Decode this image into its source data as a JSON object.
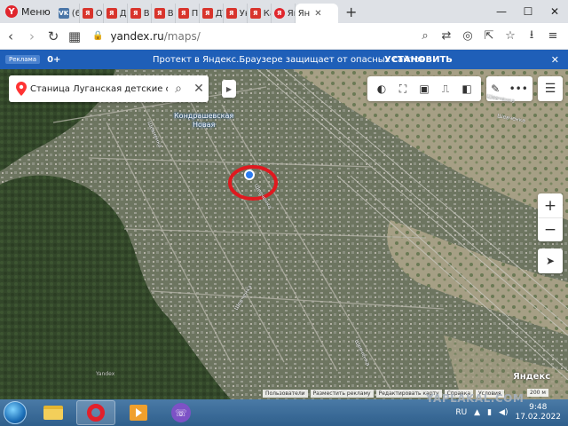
{
  "browser": {
    "menu_label": "Меню",
    "tabs": [
      {
        "label": "(6",
        "favicon": "vk",
        "active": false
      },
      {
        "label": "О",
        "favicon": "yap",
        "active": false
      },
      {
        "label": "Дс",
        "favicon": "yap",
        "active": false
      },
      {
        "label": "В",
        "favicon": "yap",
        "active": false
      },
      {
        "label": "В",
        "favicon": "yap",
        "active": false
      },
      {
        "label": "П",
        "favicon": "yap",
        "active": false
      },
      {
        "label": "ДТ",
        "favicon": "yap",
        "active": false
      },
      {
        "label": "Ук",
        "favicon": "yap",
        "active": false
      },
      {
        "label": "Ка",
        "favicon": "yap",
        "active": false
      },
      {
        "label": "Ян",
        "favicon": "ya",
        "active": false
      },
      {
        "label": "Ян",
        "favicon": "map",
        "active": true
      }
    ],
    "address": {
      "host": "yandex.ru",
      "path": "/maps/"
    }
  },
  "protect_banner": {
    "badge": "Реклама",
    "age": "0+",
    "message": "Протект в Яндекс.Браузере защищает от опасных сайтов",
    "install_label": "УСТАНОВИТЬ"
  },
  "map": {
    "search_value": "Станица Луганская детские сад",
    "place_label_line1": "Кондрашевская",
    "place_label_line2": "Новая",
    "brand": "Яндекс",
    "copyright_links": [
      "Пользователи",
      "Разместить рекламу",
      "Редактировать карту",
      "Справка",
      "Условия"
    ],
    "scale": "200 м",
    "streets": [
      "Шевченка",
      "Шевченка",
      "Yandex",
      "Шевченка",
      "Шевченка",
      "Шевченка",
      "Шевченка"
    ]
  },
  "taskbar": {
    "lang": "RU",
    "time": "9:48",
    "date": "17.02.2022"
  },
  "watermark": "YAPLAKAL.COM",
  "colors": {
    "banner": "#1f5fb8",
    "highlight_circle": "#e0191f",
    "location_dot": "#2a7cf0"
  }
}
